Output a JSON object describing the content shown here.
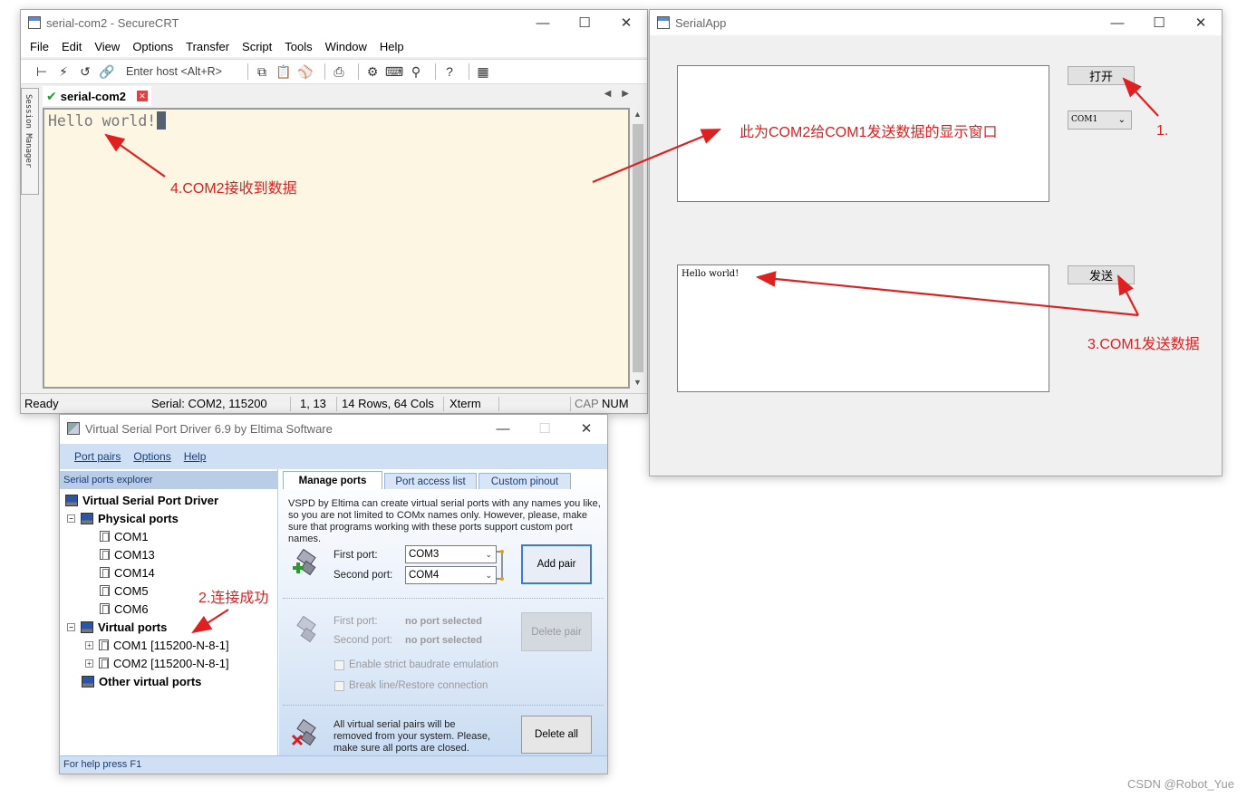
{
  "securecrt": {
    "title": "serial-com2 - SecureCRT",
    "menu": [
      "File",
      "Edit",
      "View",
      "Options",
      "Transfer",
      "Script",
      "Tools",
      "Window",
      "Help"
    ],
    "enter_host": "Enter host <Alt+R>",
    "session_manager": "Session Manager",
    "tab_label": "serial-com2",
    "terminal_text": "Hello world!",
    "status": {
      "ready": "Ready",
      "serial": "Serial: COM2, 115200",
      "position": "1,  13",
      "size": "14 Rows, 64 Cols",
      "term": "Xterm",
      "cap": "CAP",
      "num": "NUM"
    }
  },
  "serialapp": {
    "title": "SerialApp",
    "open_button": "打开",
    "port_select": "COM1",
    "send_button": "发送",
    "send_text": "Hello world!"
  },
  "vspd": {
    "title": "Virtual Serial Port Driver 6.9 by Eltima Software",
    "menu": [
      "Port pairs",
      "Options",
      "Help"
    ],
    "explorer_header": "Serial ports explorer",
    "tree": {
      "root": "Virtual Serial Port Driver",
      "physical": "Physical ports",
      "physical_ports": [
        "COM1",
        "COM13",
        "COM14",
        "COM5",
        "COM6"
      ],
      "virtual": "Virtual ports",
      "virtual_ports": [
        "COM1 [115200-N-8-1]",
        "COM2 [115200-N-8-1]"
      ],
      "other": "Other virtual ports"
    },
    "tabs": [
      "Manage ports",
      "Port access list",
      "Custom pinout"
    ],
    "description": "VSPD by Eltima can create virtual serial ports with any names you like, so you are not limited to COMx names only. However, please, make sure that programs working with these ports support custom port names.",
    "add": {
      "first_label": "First port:",
      "first_value": "COM3",
      "second_label": "Second port:",
      "second_value": "COM4",
      "button": "Add pair"
    },
    "delete": {
      "first_label": "First port:",
      "first_value": "no port selected",
      "second_label": "Second port:",
      "second_value": "no port selected",
      "button": "Delete pair",
      "strict": "Enable strict baudrate emulation",
      "break": "Break line/Restore connection"
    },
    "delete_all": {
      "text": "All virtual serial pairs will be removed from your system. Please, make sure all ports are closed.",
      "button": "Delete all"
    },
    "status": "For help press F1"
  },
  "annotations": {
    "a1": "1.",
    "a2": "2.连接成功",
    "a3": "3.COM1发送数据",
    "a4": "4.COM2接收到数据",
    "display": "此为COM2给COM1发送数据的显示窗口"
  },
  "watermark": "CSDN @Robot_Yue",
  "colors": {
    "annotation": "#e02020",
    "terminal_bg": "#fdf6e3",
    "vspd_accent": "#cfe0f4"
  }
}
